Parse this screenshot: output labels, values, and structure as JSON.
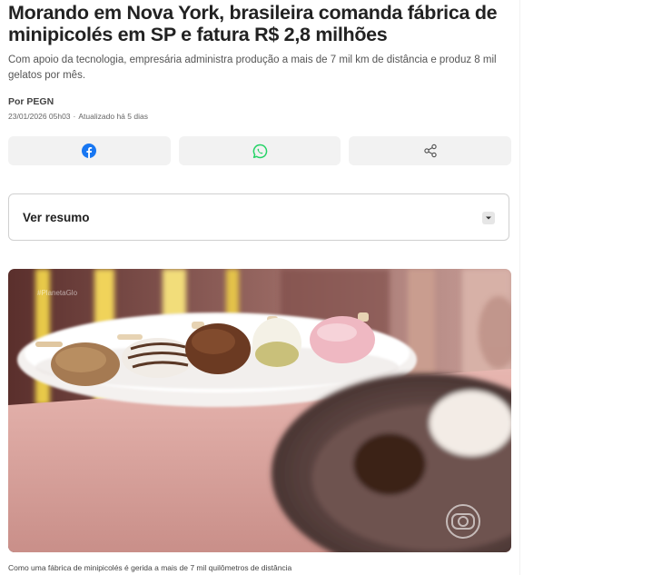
{
  "article": {
    "headline": "Morando em Nova York, brasileira comanda fábrica de minipicolés em SP e fatura R$ 2,8 milhões",
    "subtitle": "Com apoio da tecnologia, empresária administra produção a mais de 7 mil km de distância e produz 8 mil gelatos por mês.",
    "byline": "Por PEGN",
    "published": "23/01/2026 05h03",
    "separator": "·",
    "updated": "Atualizado há 5 dias"
  },
  "share": {
    "buttons": [
      {
        "icon": "facebook-icon",
        "color": "#1877f2"
      },
      {
        "icon": "whatsapp-icon",
        "color": "#25d366"
      },
      {
        "icon": "share-icon",
        "color": "#555555"
      }
    ]
  },
  "summary": {
    "label": "Ver resumo"
  },
  "media": {
    "watermark": "#PlanetaGlo",
    "caption": "Como uma fábrica de minipicolés é gerida a mais de 7 mil quilômetros de distância"
  }
}
